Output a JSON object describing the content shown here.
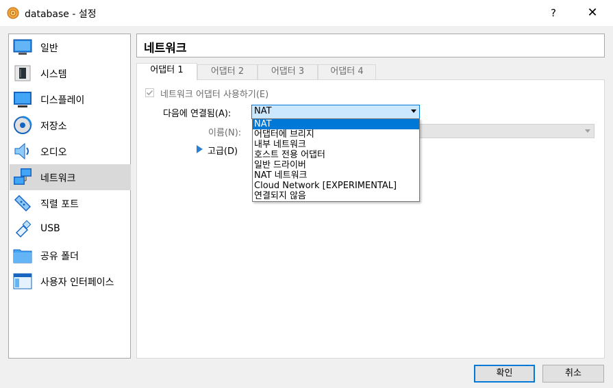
{
  "window": {
    "title": "database - 설정",
    "help_label": "?",
    "close_label": "✕"
  },
  "sidebar": {
    "items": [
      {
        "label": "일반",
        "icon": "monitor-icon"
      },
      {
        "label": "시스템",
        "icon": "chip-icon"
      },
      {
        "label": "디스플레이",
        "icon": "display-icon"
      },
      {
        "label": "저장소",
        "icon": "disk-icon"
      },
      {
        "label": "오디오",
        "icon": "speaker-icon"
      },
      {
        "label": "네트워크",
        "icon": "network-icon",
        "selected": true
      },
      {
        "label": "직렬 포트",
        "icon": "serial-port-icon"
      },
      {
        "label": "USB",
        "icon": "usb-icon"
      },
      {
        "label": "공유 폴더",
        "icon": "folder-icon"
      },
      {
        "label": "사용자 인터페이스",
        "icon": "window-icon"
      }
    ]
  },
  "header": {
    "title": "네트워크"
  },
  "tabs": [
    {
      "label": "어댑터 1",
      "active": true
    },
    {
      "label": "어댑터 2"
    },
    {
      "label": "어댑터 3"
    },
    {
      "label": "어댑터 4"
    }
  ],
  "adapter": {
    "enable_label": "네트워크 어댑터 사용하기(E)",
    "enable_checked": true,
    "attached_label": "다음에 연결됨(A):",
    "attached_value": "NAT",
    "name_label": "이름(N):",
    "name_value": "",
    "advanced_label": "고급(D)"
  },
  "dropdown": {
    "options": [
      "NAT",
      "어댑터에 브리지",
      "내부 네트워크",
      "호스트 전용 어댑터",
      "일반 드라이버",
      "NAT 네트워크",
      "Cloud Network [EXPERIMENTAL]",
      "연결되지 않음"
    ],
    "selected_index": 0
  },
  "buttons": {
    "ok_label": "확인",
    "cancel_label": "취소"
  },
  "colors": {
    "accent": "#0078d7",
    "selection_bg": "#d9d9d9",
    "combo_bg": "#cce8ff"
  }
}
